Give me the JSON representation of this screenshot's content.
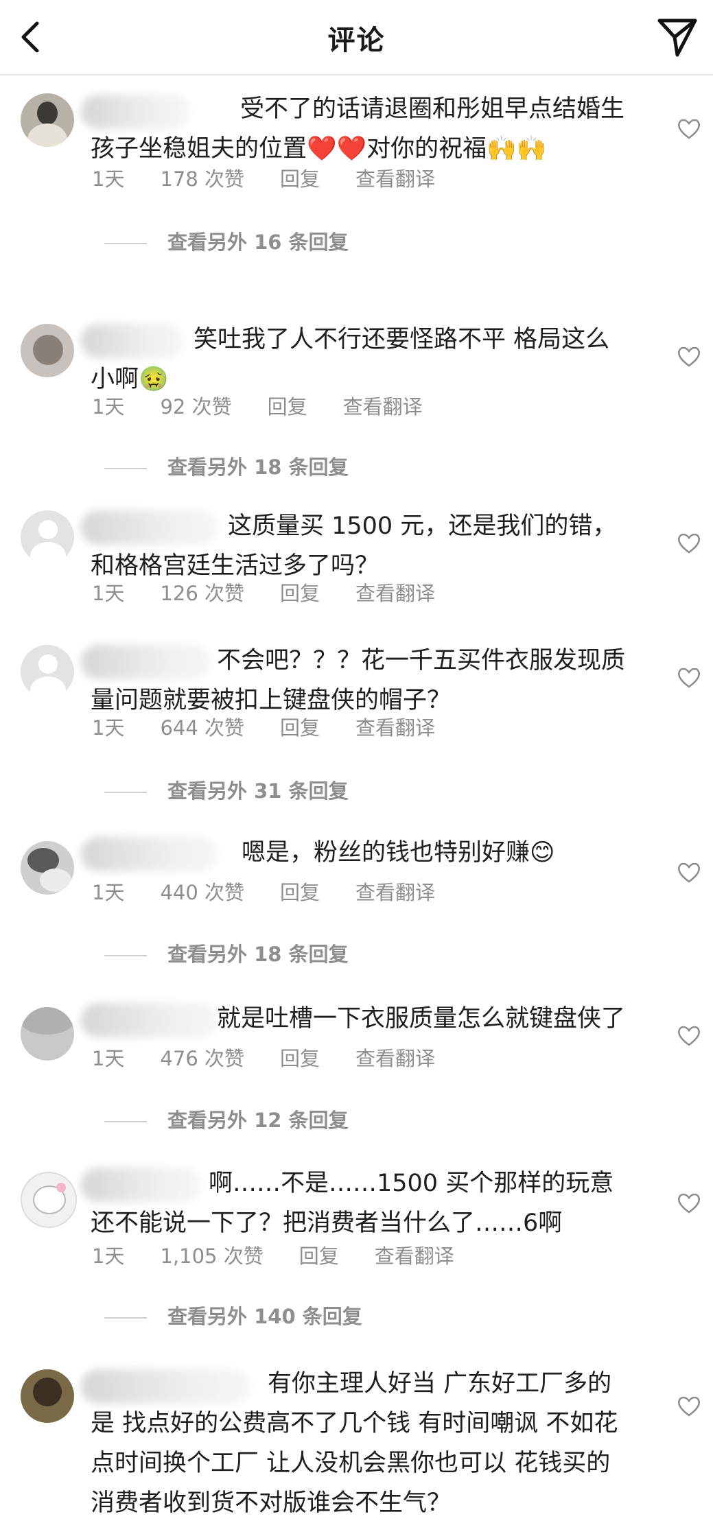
{
  "header": {
    "title": "评论"
  },
  "comments": [
    {
      "text": "受不了的话请退圈和彤姐早点结婚生孩子坐稳姐夫的位置❤️❤️对你的祝福🙌🙌",
      "time": "1天",
      "likes": "178 次赞",
      "reply": "回复",
      "translate": "查看翻译",
      "more_replies": "查看另外 16 条回复"
    },
    {
      "text": "笑吐我了人不行还要怪路不平 格局这么小啊🤢",
      "time": "1天",
      "likes": "92 次赞",
      "reply": "回复",
      "translate": "查看翻译",
      "more_replies": "查看另外 18 条回复"
    },
    {
      "text": "这质量买 1500 元，还是我们的错，和格格宫廷生活过多了吗？",
      "time": "1天",
      "likes": "126 次赞",
      "reply": "回复",
      "translate": "查看翻译",
      "more_replies": ""
    },
    {
      "text": "不会吧？？？花一千五买件衣服发现质量问题就要被扣上键盘侠的帽子？",
      "time": "1天",
      "likes": "644 次赞",
      "reply": "回复",
      "translate": "查看翻译",
      "more_replies": "查看另外 31 条回复"
    },
    {
      "text": "嗯是，粉丝的钱也特别好赚😊",
      "time": "1天",
      "likes": "440 次赞",
      "reply": "回复",
      "translate": "查看翻译",
      "more_replies": "查看另外 18 条回复"
    },
    {
      "text": "就是吐槽一下衣服质量怎么就键盘侠了",
      "time": "1天",
      "likes": "476 次赞",
      "reply": "回复",
      "translate": "查看翻译",
      "more_replies": "查看另外 12 条回复"
    },
    {
      "text": "啊……不是……1500 买个那样的玩意还不能说一下了？把消费者当什么了……6啊",
      "time": "1天",
      "likes": "1,105 次赞",
      "reply": "回复",
      "translate": "查看翻译",
      "more_replies": "查看另外 140 条回复"
    },
    {
      "text": "有你主理人好当 广东好工厂多的是 找点好的公费高不了几个钱 有时间嘲讽 不如花点时间换个工厂 让人没机会黑你也可以 花钱买的消费者收到货不对版谁会不生气？",
      "time": "",
      "likes": "",
      "reply": "",
      "translate": "",
      "more_replies": ""
    }
  ],
  "icons": {
    "back": "chevron-left-icon",
    "share": "send-icon",
    "like": "heart-outline-icon"
  }
}
